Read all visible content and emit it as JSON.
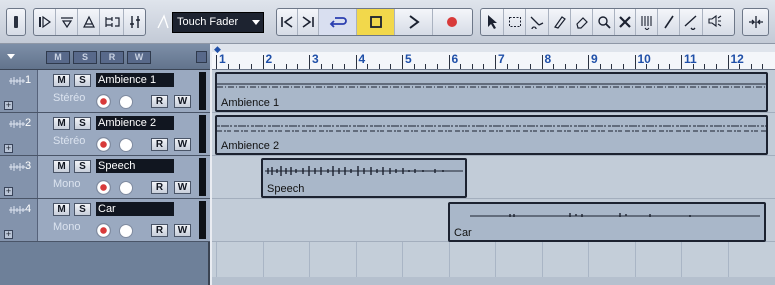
{
  "toolbar": {
    "fader_mode": "Touch Fader",
    "icons": [
      "panel-icon",
      "edit-tools-icon",
      "mixer-icon",
      "pool-icon",
      "tracks-icon",
      "automation-icon",
      "go-start-icon",
      "cycle-icon",
      "stop-icon",
      "play-icon",
      "record-icon",
      "arrow-tool-icon",
      "range-tool-icon",
      "split-tool-icon",
      "glue-tool-icon",
      "erase-tool-icon",
      "zoom-tool-icon",
      "mute-tool-icon",
      "time-warp-icon",
      "draw-tool-icon",
      "line-tool-icon",
      "speaker-icon",
      "snap-icon"
    ]
  },
  "tracklist": {
    "header_buttons": [
      "M",
      "S",
      "R",
      "W"
    ],
    "tracks": [
      {
        "number": "1",
        "name": "Ambience 1",
        "channel": "Stéréo",
        "mute": "M",
        "solo": "S",
        "read": "R",
        "write": "W"
      },
      {
        "number": "2",
        "name": "Ambience 2",
        "channel": "Stéréo",
        "mute": "M",
        "solo": "S",
        "read": "R",
        "write": "W"
      },
      {
        "number": "3",
        "name": "Speech",
        "channel": "Mono",
        "mute": "M",
        "solo": "S",
        "read": "R",
        "write": "W"
      },
      {
        "number": "4",
        "name": "Car",
        "channel": "Mono",
        "mute": "M",
        "solo": "S",
        "read": "R",
        "write": "W"
      }
    ]
  },
  "ruler": {
    "bars": [
      "1",
      "2",
      "3",
      "4",
      "5",
      "6",
      "7",
      "8",
      "9",
      "10",
      "11",
      "12"
    ]
  },
  "events": [
    {
      "name": "Ambience 1",
      "track": 1
    },
    {
      "name": "Ambience 2",
      "track": 2
    },
    {
      "name": "Speech",
      "track": 3
    },
    {
      "name": "Car",
      "track": 4
    }
  ],
  "colors": {
    "tracklist_bg": "#6e8099",
    "track_bg": "#9aa9c0",
    "event_bg": "#a9b7c9",
    "ruler_label": "#1f4fa8",
    "record": "#d83a3a"
  }
}
